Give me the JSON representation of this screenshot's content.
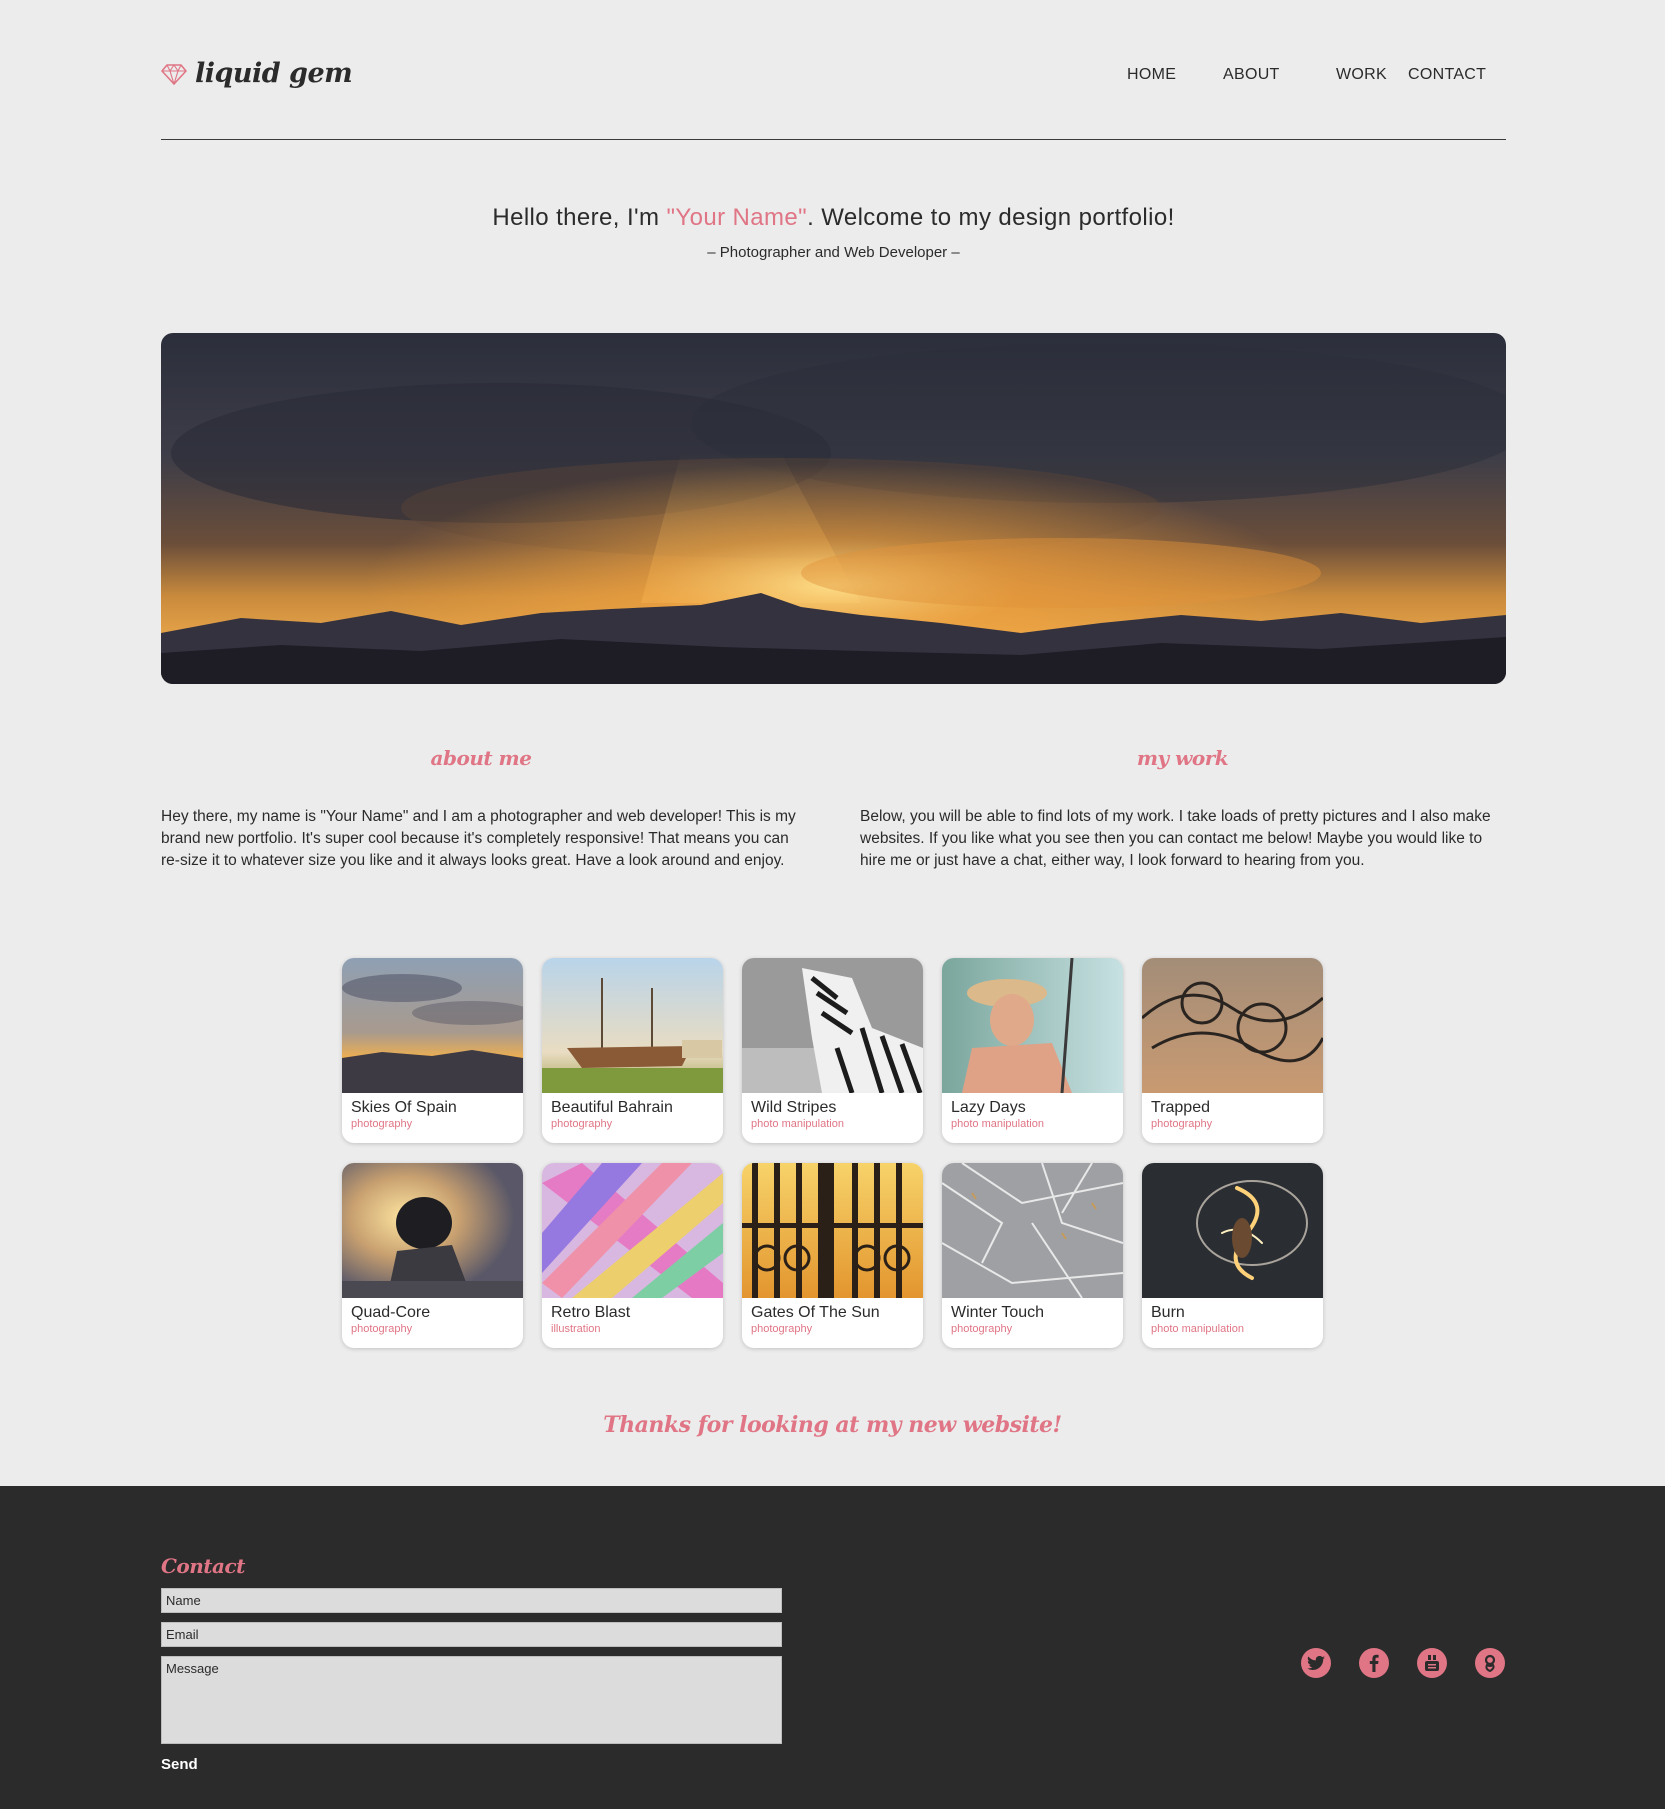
{
  "brand": {
    "name": "liquid gem",
    "icon": "diamond-icon",
    "accent": "#e07585"
  },
  "nav": [
    "HOME",
    "ABOUT",
    "WORK",
    "CONTACT"
  ],
  "intro": {
    "greeting_before": "Hello there, I'm ",
    "name": "\"Your Name\"",
    "greeting_after": ". Welcome to my design portfolio!",
    "tagline": "– Photographer and Web Developer –"
  },
  "about": {
    "title": "about me",
    "text": "Hey there, my name is \"Your Name\" and I am a photographer and web developer! This is my brand new portfolio. It's super cool because it's completely responsive! That means you can re-size it to whatever size you like and it always looks great. Have a look around and enjoy."
  },
  "work": {
    "title": "my work",
    "text": "Below, you will be able to find lots of my work. I take loads of pretty pictures and I also make websites. If you like what you see then you can contact me below! Maybe you would like to hire me or just have a chat, either way, I look forward to hearing from you."
  },
  "gallery": [
    {
      "title": "Skies Of Spain",
      "category": "photography"
    },
    {
      "title": "Beautiful Bahrain",
      "category": "photography"
    },
    {
      "title": "Wild Stripes",
      "category": "photo manipulation"
    },
    {
      "title": "Lazy Days",
      "category": "photo manipulation"
    },
    {
      "title": "Trapped",
      "category": "photography"
    },
    {
      "title": "Quad-Core",
      "category": "photography"
    },
    {
      "title": "Retro Blast",
      "category": "illustration"
    },
    {
      "title": "Gates Of The Sun",
      "category": "photography"
    },
    {
      "title": "Winter Touch",
      "category": "photography"
    },
    {
      "title": "Burn",
      "category": "photo manipulation"
    }
  ],
  "thanks": "Thanks for looking at my new website!",
  "contact": {
    "title": "Contact",
    "name_placeholder": "Name",
    "email_placeholder": "Email",
    "message_placeholder": "Message",
    "send_label": "Send"
  },
  "social": [
    "twitter-icon",
    "facebook-icon",
    "youtube-icon",
    "google-plus-icon"
  ]
}
